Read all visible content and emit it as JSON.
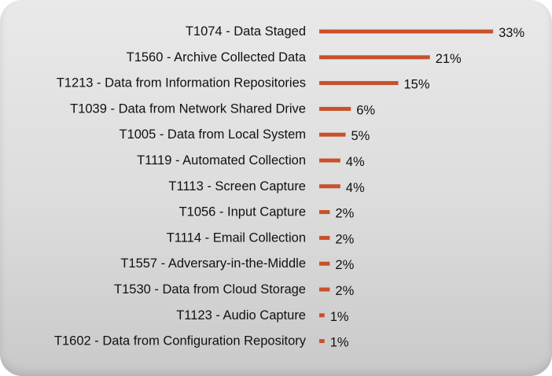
{
  "chart_data": {
    "type": "bar",
    "orientation": "horizontal",
    "categories": [
      "T1074 - Data Staged",
      "T1560 - Archive Collected Data",
      "T1213 - Data from Information Repositories",
      "T1039 - Data from Network Shared Drive",
      "T1005 - Data from Local System",
      "T1119 - Automated Collection",
      "T1113 - Screen Capture",
      "T1056 - Input Capture",
      "T1114 - Email Collection",
      "T1557 - Adversary-in-the-Middle",
      "T1530 - Data from Cloud Storage",
      "T1123 - Audio Capture",
      "T1602 - Data from Configuration Repository"
    ],
    "values": [
      33,
      21,
      15,
      6,
      5,
      4,
      4,
      2,
      2,
      2,
      2,
      1,
      1
    ],
    "value_labels": [
      "33%",
      "21%",
      "15%",
      "6%",
      "5%",
      "4%",
      "4%",
      "2%",
      "2%",
      "2%",
      "2%",
      "1%",
      "1%"
    ],
    "unit": "%",
    "bar_color": "#c8502a",
    "grid": false,
    "legend": "none"
  }
}
